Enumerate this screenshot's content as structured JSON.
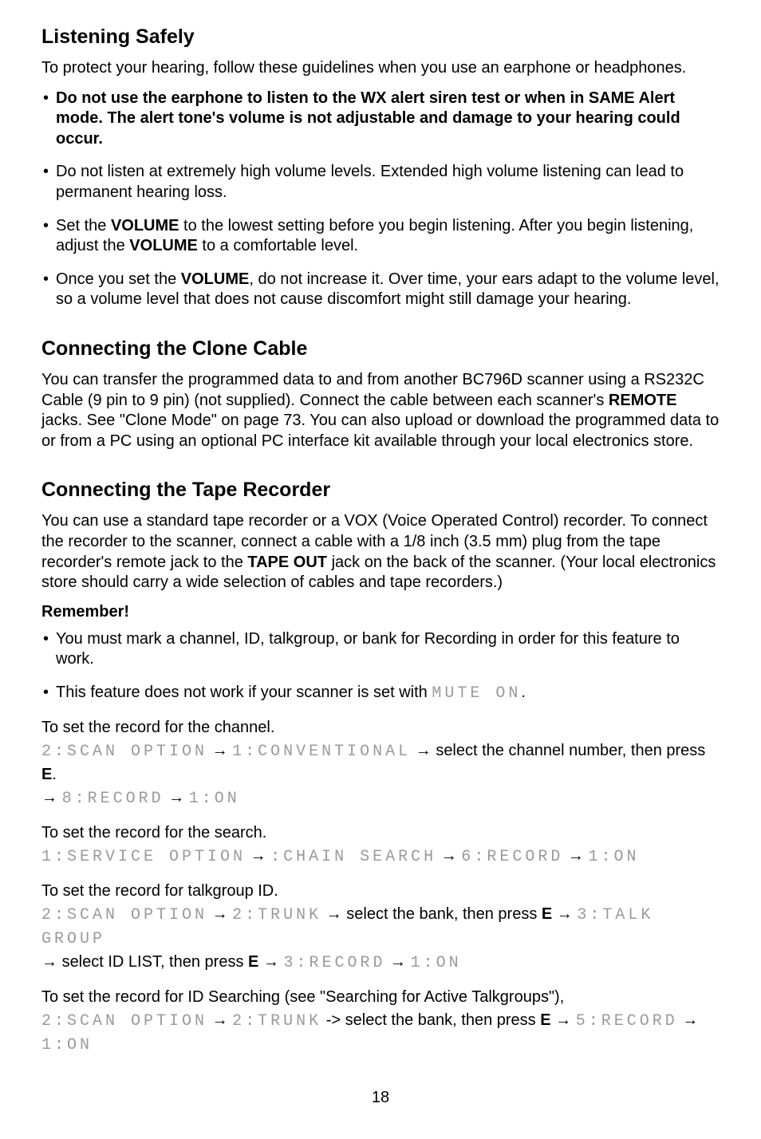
{
  "headings": {
    "h1": "Listening Safely",
    "h2": "Connecting the Clone Cable",
    "h3": "Connecting the Tape Recorder"
  },
  "intro": {
    "p1": "To protect your hearing, follow these guidelines when you use an earphone or headphones."
  },
  "bullets1": {
    "b1": "Do not use the earphone to listen to the WX alert siren test or when in SAME Alert mode. The alert tone's volume is not adjustable and damage to your hearing could occur.",
    "b2": "Do not listen at extremely high volume levels. Extended high volume listening can lead to permanent hearing loss.",
    "b3a": "Set the ",
    "b3_vol": "VOLUME",
    "b3b": " to the lowest setting before you begin listening. After you begin listening, adjust the ",
    "b3_vol2": "VOLUME",
    "b3c": " to a comfortable level.",
    "b4a": "Once you set the ",
    "b4_vol": "VOLUME",
    "b4b": ", do not increase it. Over time, your ears adapt to the volume level, so a volume level that does not cause discomfort might still damage your hearing."
  },
  "clone": {
    "p_a": "You can transfer the programmed data to and from another BC796D scanner using a RS232C Cable (9 pin to 9 pin) (not supplied). Connect the cable between each scanner's ",
    "remote": "REMOTE",
    "p_b": " jacks. See \"Clone Mode\" on page 73. You can also upload or download the programmed data to or from a PC using an optional PC interface kit available through your local electronics store."
  },
  "tape": {
    "p_a": "You can use a standard tape recorder or a VOX (Voice Operated Control) recorder. To connect the recorder to the scanner, connect a cable with a 1/8 inch (3.5 mm) plug from the tape recorder's remote jack to the ",
    "tapeout": "TAPE OUT",
    "p_b": " jack on the back of the scanner. (Your local electronics store should carry a wide selection of cables and tape recorders.)"
  },
  "remember": "Remember!",
  "bullets2": {
    "b1": "You must mark a channel, ID, talkgroup, or bank for Recording in order for this feature to work.",
    "b2a": "This feature does not work if your scanner is set with ",
    "b2_mute": "MUTE ON",
    "b2b": "."
  },
  "steps": {
    "s1_label": "To set the record for the channel.",
    "s1_scan": "2:SCAN OPTION",
    "s1_conv": "1:CONVENTIONAL",
    "s1_mid": " select the channel number, then press ",
    "s1_e": "E",
    "s1_period": ".",
    "s1_rec": "8:RECORD",
    "s1_on": "1:ON",
    "s2_label": "To set the record for the search.",
    "s2_service": "1:SERVICE OPTION",
    "s2_chain": ":CHAIN SEARCH",
    "s2_rec": "6:RECORD",
    "s2_on": "1:ON",
    "s3_label": "To set the record for talkgroup ID.",
    "s3_scan": "2:SCAN OPTION",
    "s3_trunk": "2:TRUNK",
    "s3_selbank": " select the bank, then press ",
    "s3_e": "E",
    "s3_talk": "3:TALK GROUP",
    "s3_selid": " select ID LIST, then press ",
    "s3_e2": "E",
    "s3_rec": "3:RECORD",
    "s3_on": "1:ON",
    "s4_label": "To set the record for ID Searching (see \"Searching for Active Talkgroups\"),",
    "s4_scan": "2:SCAN OPTION",
    "s4_trunk": "2:TRUNK",
    "s4_hyphenarrow": " -> select the bank, then press ",
    "s4_e": "E",
    "s4_rec": "5:RECORD",
    "s4_on": "1:ON"
  },
  "arrow": "→",
  "page_number": "18"
}
